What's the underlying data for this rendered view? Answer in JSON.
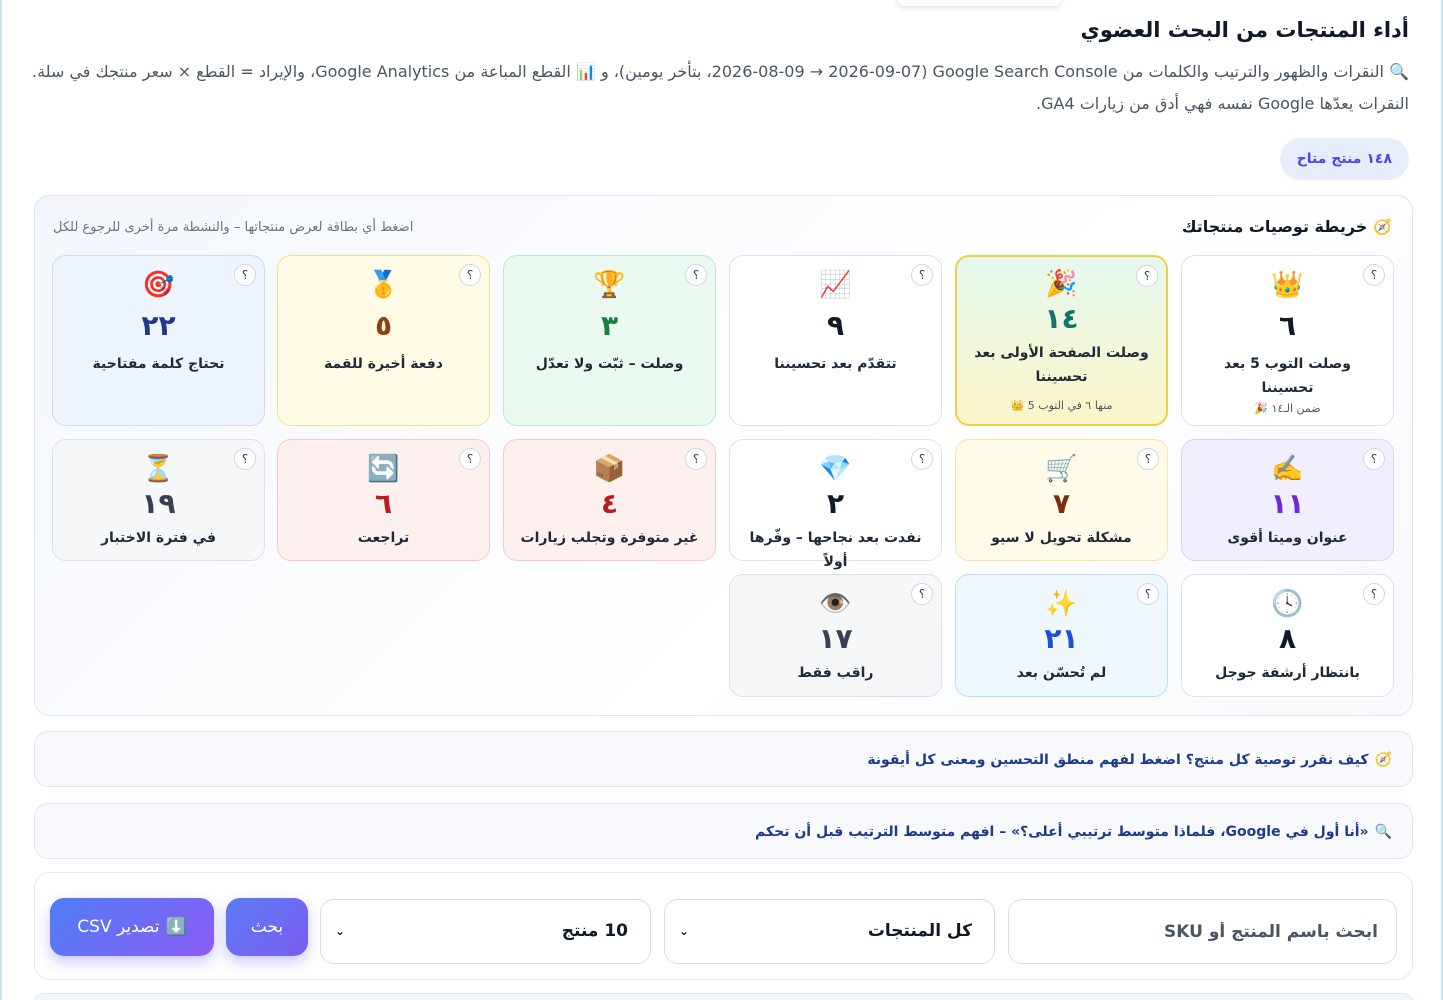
{
  "header": {
    "title": "أداء المنتجات من البحث العضوي",
    "description": "🔍 النقرات والظهور والترتيب والكلمات من Google Search Console (2026-08-09 → 2026-09-07، بتأخر يومين)، و 📊 القطع المباعة من Google Analytics، والإيراد = القطع × سعر منتجك في سلة. النقرات يعدّها Google نفسه فهي أدق من زيارات GA4.",
    "products_available": "١٤٨ منتج متاح"
  },
  "map": {
    "title_emoji": "🧭",
    "title": "خريطة توصيات منتجاتك",
    "hint": "اضغط أي بطاقة لعرض منتجاتها – والنشطة مرة أخرى للرجوع للكل",
    "help_symbol": "؟",
    "cards": [
      {
        "emoji": "👑",
        "count": "٦",
        "label": "وصلت التوب 5 بعد تحسيننا",
        "sub": "ضمن الـ١٤ 🎉"
      },
      {
        "emoji": "🎉",
        "count": "١٤",
        "label": "وصلت الصفحة الأولى بعد تحسيننا",
        "sub": "منها ٦ في التوب 5 👑"
      },
      {
        "emoji": "📈",
        "count": "٩",
        "label": "تتقدّم بعد تحسيننا"
      },
      {
        "emoji": "🏆",
        "count": "٣",
        "label": "وصلت – ثبّت ولا تعدّل"
      },
      {
        "emoji": "🥇",
        "count": "٥",
        "label": "دفعة أخيرة للقمة"
      },
      {
        "emoji": "🎯",
        "count": "٢٢",
        "label": "تحتاج كلمة مفتاحية"
      },
      {
        "emoji": "✍️",
        "count": "١١",
        "label": "عنوان وميتا أقوى"
      },
      {
        "emoji": "🛒",
        "count": "٧",
        "label": "مشكلة تحويل لا سيو"
      },
      {
        "emoji": "💎",
        "count": "٢",
        "label": "نفدت بعد نجاحها – وفّرها أولاً"
      },
      {
        "emoji": "📦",
        "count": "٤",
        "label": "غير متوفرة وتجلب زيارات"
      },
      {
        "emoji": "🔄",
        "count": "٦",
        "label": "تراجعت"
      },
      {
        "emoji": "⏳",
        "count": "١٩",
        "label": "في فترة الاختبار"
      },
      {
        "emoji": "🕓",
        "count": "٨",
        "label": "بانتظار أرشفة جوجل"
      },
      {
        "emoji": "✨",
        "count": "٢١",
        "label": "لم تُحسّن بعد"
      },
      {
        "emoji": "👁️",
        "count": "١٧",
        "label": "راقب فقط"
      }
    ]
  },
  "accordions": [
    {
      "emoji": "🧭",
      "label": "كيف نقرر توصية كل منتج؟ اضغط لفهم منطق التحسين ومعنى كل أيقونة"
    },
    {
      "emoji": "🔍",
      "label": "«أنا أول في Google، فلماذا متوسط ترتيبي أعلى؟» – افهم متوسط الترتيب قبل أن تحكم"
    }
  ],
  "toolbar": {
    "search_placeholder": "ابحث باسم المنتج أو SKU",
    "filter_value": "كل المنتجات",
    "page_size_value": "10 منتج",
    "chevron": "⌄",
    "search_button": "بحث",
    "export_emoji": "⬇️",
    "export_button": "تصدير CSV"
  }
}
